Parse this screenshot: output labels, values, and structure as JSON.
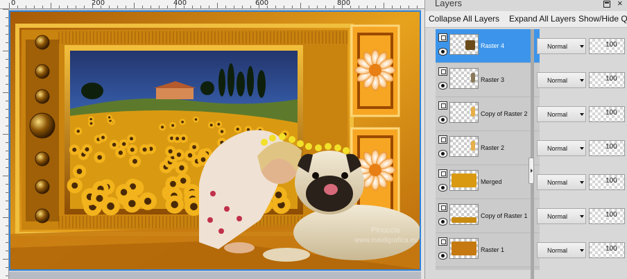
{
  "ruler": {
    "marks": [
      "0",
      "200",
      "400",
      "600",
      "800"
    ]
  },
  "canvas": {
    "watermark": "www.maidigrafica.eu",
    "artist": "Pinuccia"
  },
  "panel": {
    "title": "Layers",
    "close_glyph": "×",
    "toolbar": {
      "collapse_label": "Collapse All Layers",
      "expand_label": "Expand All Layers",
      "showhide_label": "Show/Hide Qu"
    },
    "layers": [
      {
        "name": "Raster 4",
        "blend": "Normal",
        "opacity": "100",
        "selected": true
      },
      {
        "name": "Raster 3",
        "blend": "Normal",
        "opacity": "100",
        "selected": false
      },
      {
        "name": "Copy of Raster 2",
        "blend": "Normal",
        "opacity": "100",
        "selected": false
      },
      {
        "name": "Raster 2",
        "blend": "Normal",
        "opacity": "100",
        "selected": false
      },
      {
        "name": "Merged",
        "blend": "Normal",
        "opacity": "100",
        "selected": false
      },
      {
        "name": "Copy of Raster 1",
        "blend": "Normal",
        "opacity": "100",
        "selected": false
      },
      {
        "name": "Raster 1",
        "blend": "Normal",
        "opacity": "100",
        "selected": false
      }
    ]
  },
  "colors": {
    "selection_blue": "#3c95ea",
    "frame_gold": "#c98a10",
    "sky_blue": "#3f6fc4",
    "sunflower_yellow": "#f0b020"
  }
}
